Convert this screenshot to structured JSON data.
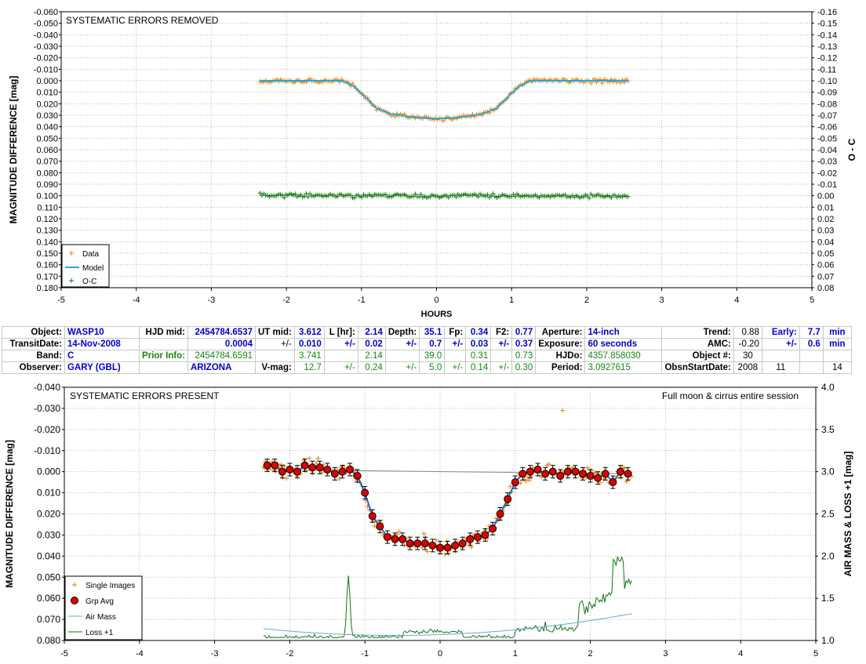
{
  "top_chart": {
    "title": "SYSTEMATIC ERRORS REMOVED",
    "ylabel": "MAGNITUDE DIFFERENCE [mag]",
    "y2label": "O - C",
    "xlabel": "HOURS",
    "xlim": [
      -5,
      5
    ],
    "ylim": [
      -0.06,
      0.18
    ],
    "y2lim": [
      -0.16,
      0.08
    ],
    "yticks": [
      "-0.060",
      "-0.050",
      "-0.040",
      "-0.030",
      "-0.020",
      "-0.010",
      "0.000",
      "0.010",
      "0.020",
      "0.030",
      "0.040",
      "0.050",
      "0.060",
      "0.070",
      "0.080",
      "0.090",
      "0.100",
      "0.110",
      "0.120",
      "0.130",
      "0.140",
      "0.150",
      "0.160",
      "0.170",
      "0.180"
    ],
    "y2ticks": [
      "-0.16",
      "-0.15",
      "-0.14",
      "-0.13",
      "-0.12",
      "-0.11",
      "-0.10",
      "-0.09",
      "-0.08",
      "-0.07",
      "-0.06",
      "-0.05",
      "-0.04",
      "-0.03",
      "-0.02",
      "-0.01",
      "0.00",
      "0.01",
      "0.02",
      "0.03",
      "0.04",
      "0.05",
      "0.06",
      "0.07",
      "0.08"
    ],
    "xticks": [
      "-5",
      "-4",
      "-3",
      "-2",
      "-1",
      "0",
      "1",
      "2",
      "3",
      "4",
      "5"
    ],
    "legend": [
      "Data",
      "Model",
      "O-C"
    ],
    "colors": {
      "data": "#e8820c",
      "model": "#22aadd",
      "oc": "#117711"
    }
  },
  "bottom_chart": {
    "title": "SYSTEMATIC ERRORS PRESENT",
    "annotation": "Full moon & cirrus entire session",
    "ylabel": "MAGNITUDE DIFFERENCE [mag]",
    "y2label": "AIR MASS & LOSS +1 [mag]",
    "xlim": [
      -5,
      5
    ],
    "ylim": [
      -0.04,
      0.08
    ],
    "y2lim": [
      1.0,
      4.0
    ],
    "yticks": [
      "-0.040",
      "-0.030",
      "-0.020",
      "-0.010",
      "0.000",
      "0.010",
      "0.020",
      "0.030",
      "0.040",
      "0.050",
      "0.060",
      "0.070",
      "0.080"
    ],
    "y2ticks": [
      "4.0",
      "3.5",
      "3.0",
      "2.5",
      "2.0",
      "1.5",
      "1.0"
    ],
    "xticks": [
      "-5",
      "-4",
      "-3",
      "-2",
      "-1",
      "0",
      "1",
      "2",
      "3",
      "4",
      "5"
    ],
    "legend": [
      "Single Images",
      "Grp Avg",
      "Air Mass",
      "Loss +1"
    ],
    "colors": {
      "single": "#e8820c",
      "grp": "#dd0000",
      "model": "#2266dd",
      "airmass": "#66aacc",
      "loss": "#117711",
      "ref": "#888888"
    }
  },
  "chart_data": [
    {
      "type": "scatter",
      "title": "SYSTEMATIC ERRORS REMOVED",
      "model": {
        "x": [
          -2.35,
          -1.25,
          -1.1,
          -0.95,
          -0.8,
          -0.6,
          -0.3,
          0,
          0.3,
          0.6,
          0.8,
          0.95,
          1.1,
          1.25,
          2.55
        ],
        "y": [
          0.0,
          0.0,
          0.005,
          0.014,
          0.024,
          0.029,
          0.032,
          0.033,
          0.032,
          0.029,
          0.024,
          0.014,
          0.005,
          0.0,
          0.0
        ]
      },
      "data_range_hours": [
        -2.35,
        2.55
      ],
      "oc_level": 0.0,
      "oc_offset_axis": 0.1
    },
    {
      "type": "scatter",
      "title": "SYSTEMATIC ERRORS PRESENT",
      "grp_avg": {
        "x": [
          -2.3,
          -2.2,
          -2.1,
          -2.0,
          -1.9,
          -1.8,
          -1.7,
          -1.6,
          -1.5,
          -1.4,
          -1.3,
          -1.2,
          -1.1,
          -1.0,
          -0.9,
          -0.8,
          -0.7,
          -0.6,
          -0.5,
          -0.4,
          -0.3,
          -0.2,
          -0.1,
          0.0,
          0.1,
          0.2,
          0.3,
          0.4,
          0.5,
          0.6,
          0.7,
          0.8,
          0.9,
          1.0,
          1.1,
          1.2,
          1.3,
          1.4,
          1.5,
          1.6,
          1.7,
          1.8,
          1.9,
          2.0,
          2.1,
          2.2,
          2.3,
          2.4,
          2.5
        ],
        "y": [
          -0.003,
          -0.003,
          0.0,
          -0.001,
          0.0,
          -0.003,
          -0.002,
          -0.002,
          -0.001,
          0.001,
          0.0,
          -0.001,
          0.002,
          0.01,
          0.021,
          0.026,
          0.031,
          0.032,
          0.032,
          0.034,
          0.034,
          0.034,
          0.035,
          0.036,
          0.036,
          0.035,
          0.034,
          0.032,
          0.031,
          0.03,
          0.027,
          0.02,
          0.013,
          0.005,
          0.001,
          0.0,
          -0.001,
          0.001,
          0.0,
          0.002,
          0.0,
          0.0,
          0.001,
          0.002,
          0.003,
          0.001,
          0.005,
          0.0,
          0.001
        ]
      },
      "air_mass_range": [
        1.05,
        1.3
      ],
      "loss_peak": 2.0
    }
  ],
  "table": {
    "rows": [
      [
        {
          "t": "Object:",
          "c": "lbl",
          "w": 80
        },
        {
          "t": "WASP10",
          "c": "blue",
          "w": 95
        },
        {
          "t": "HJD mid:",
          "c": "lbl",
          "w": 62
        },
        {
          "t": "2454784.6537",
          "c": "blue num",
          "w": 86
        },
        {
          "t": "UT mid:",
          "c": "lbl",
          "w": 48
        },
        {
          "t": "3.612",
          "c": "blue num",
          "w": 38
        },
        {
          "t": "L [hr]:",
          "c": "lbl",
          "w": 43
        },
        {
          "t": "2.14",
          "c": "blue num",
          "w": 35
        },
        {
          "t": "Depth:",
          "c": "lbl",
          "w": 40
        },
        {
          "t": "35.1",
          "c": "blue num",
          "w": 32
        },
        {
          "t": "Fp:",
          "c": "lbl",
          "w": 27
        },
        {
          "t": "0.34",
          "c": "blue num",
          "w": 32
        },
        {
          "t": "F2:",
          "c": "lbl",
          "w": 27
        },
        {
          "t": "0.77",
          "c": "blue num",
          "w": 30
        },
        {
          "t": "Aperture:",
          "c": "lbl",
          "w": 62
        },
        {
          "t": "14-inch",
          "c": "blue",
          "w": 98
        },
        {
          "t": "Trend:",
          "c": "lbl",
          "w": 40
        },
        {
          "t": "0.88",
          "c": "num",
          "w": 36
        },
        {
          "t": "Early:",
          "c": "blue num",
          "w": 48
        },
        {
          "t": "7.7",
          "c": "blue num",
          "w": 30
        },
        {
          "t": "min",
          "c": "blue ctr",
          "w": 36
        }
      ],
      [
        {
          "t": "TransitDate:",
          "c": "lbl"
        },
        {
          "t": "14-Nov-2008",
          "c": "blue"
        },
        {
          "t": "",
          "c": ""
        },
        {
          "t": "0.0004",
          "c": "blue num"
        },
        {
          "t": "+/-",
          "c": "num"
        },
        {
          "t": "0.010",
          "c": "blue num"
        },
        {
          "t": "+/-",
          "c": "blue num"
        },
        {
          "t": "0.02",
          "c": "blue num"
        },
        {
          "t": "+/-",
          "c": "blue num"
        },
        {
          "t": "0.7",
          "c": "blue num"
        },
        {
          "t": "+/-",
          "c": "blue num"
        },
        {
          "t": "0.03",
          "c": "blue num"
        },
        {
          "t": "+/-",
          "c": "blue num"
        },
        {
          "t": "0.37",
          "c": "blue num"
        },
        {
          "t": "Exposure:",
          "c": "lbl"
        },
        {
          "t": "60 seconds",
          "c": "blue"
        },
        {
          "t": "AMC:",
          "c": "lbl"
        },
        {
          "t": "-0.20",
          "c": "num"
        },
        {
          "t": "+/-",
          "c": "blue num"
        },
        {
          "t": "0.6",
          "c": "blue num"
        },
        {
          "t": "min",
          "c": "blue ctr"
        }
      ],
      [
        {
          "t": "Band:",
          "c": "lbl"
        },
        {
          "t": "C",
          "c": "blue"
        },
        {
          "t": "Prior Info:",
          "c": "greenb num"
        },
        {
          "t": "2454784.6591",
          "c": "green num"
        },
        {
          "t": "",
          "c": ""
        },
        {
          "t": "3.741",
          "c": "green num"
        },
        {
          "t": "",
          "c": ""
        },
        {
          "t": "2.14",
          "c": "green num"
        },
        {
          "t": "",
          "c": ""
        },
        {
          "t": "39.0",
          "c": "green num"
        },
        {
          "t": "",
          "c": ""
        },
        {
          "t": "0.31",
          "c": "green num"
        },
        {
          "t": "",
          "c": ""
        },
        {
          "t": "0.73",
          "c": "green num"
        },
        {
          "t": "HJDo:",
          "c": "lbl"
        },
        {
          "t": "4357.858030",
          "c": "green"
        },
        {
          "t": "Object #:",
          "c": "lbl"
        },
        {
          "t": "30",
          "c": "ctr"
        },
        {
          "t": "",
          "c": ""
        },
        {
          "t": "",
          "c": ""
        },
        {
          "t": "",
          "c": ""
        }
      ],
      [
        {
          "t": "Observer:",
          "c": "lbl"
        },
        {
          "t": "GARY (GBL)",
          "c": "blue"
        },
        {
          "t": "",
          "c": ""
        },
        {
          "t": "ARIZONA",
          "c": "blue"
        },
        {
          "t": "V-mag:",
          "c": "lbl"
        },
        {
          "t": "12.7",
          "c": "green num"
        },
        {
          "t": "+/-",
          "c": "green num"
        },
        {
          "t": "0.24",
          "c": "green num"
        },
        {
          "t": "+/-",
          "c": "green num"
        },
        {
          "t": "5.0",
          "c": "green num"
        },
        {
          "t": "+/-",
          "c": "green num"
        },
        {
          "t": "0.14",
          "c": "green num"
        },
        {
          "t": "+/-",
          "c": "green num"
        },
        {
          "t": "0.30",
          "c": "green num"
        },
        {
          "t": "Period:",
          "c": "lbl"
        },
        {
          "t": "3.0927615",
          "c": "green"
        },
        {
          "t": "ObsnStartDate:",
          "c": "lbl"
        },
        {
          "t": "2008",
          "c": "ctr"
        },
        {
          "t": "11",
          "c": "ctr"
        },
        {
          "t": "",
          "c": ""
        },
        {
          "t": "14",
          "c": "ctr"
        }
      ]
    ]
  }
}
